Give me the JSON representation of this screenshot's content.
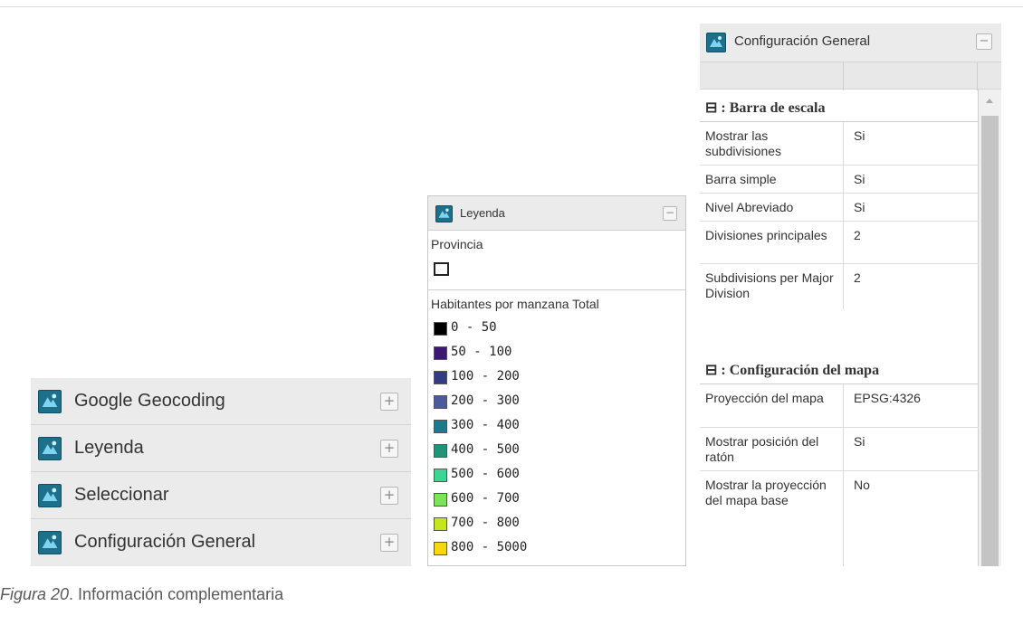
{
  "accordion": {
    "items": [
      {
        "label": "Google Geocoding",
        "icon": "layer-panel-icon"
      },
      {
        "label": "Leyenda",
        "icon": "layer-panel-icon"
      },
      {
        "label": "Seleccionar",
        "icon": "layer-panel-icon"
      },
      {
        "label": "Configuración General",
        "icon": "layer-panel-icon"
      }
    ],
    "expand_symbol": "+"
  },
  "legend_panel": {
    "title": "Leyenda",
    "collapse_symbol": "−",
    "group1_title": "Provincia",
    "group2_title": "Habitantes por manzana Total",
    "items": [
      {
        "label": "0 - 50",
        "color": "#000000"
      },
      {
        "label": "50 - 100",
        "color": "#3b1a6e"
      },
      {
        "label": "100 - 200",
        "color": "#333b85"
      },
      {
        "label": "200 - 300",
        "color": "#4a5a9a"
      },
      {
        "label": "300 - 400",
        "color": "#1d7a88"
      },
      {
        "label": "400 - 500",
        "color": "#1f9478"
      },
      {
        "label": "500 - 600",
        "color": "#3cd694"
      },
      {
        "label": "600 - 700",
        "color": "#7fe35a"
      },
      {
        "label": "700 - 800",
        "color": "#c5e51f"
      },
      {
        "label": "800 - 5000",
        "color": "#f5d910"
      }
    ]
  },
  "config_panel": {
    "title": "Configuración General",
    "collapse_symbol": "−",
    "section1": "⊟ : Barra de escala",
    "section1_props": [
      {
        "key": "Mostrar las subdivisiones",
        "value": "Si"
      },
      {
        "key": "Barra simple",
        "value": "Si"
      },
      {
        "key": "Nivel Abreviado",
        "value": "Si"
      },
      {
        "key": "Divisiones principales",
        "value": "2"
      },
      {
        "key": "Subdivisions per Major Division",
        "value": "2"
      }
    ],
    "section2": "⊟ : Configuración del mapa",
    "section2_props": [
      {
        "key": "Proyección del mapa",
        "value": "EPSG:4326"
      },
      {
        "key": "Mostrar posición del ratón",
        "value": "Si"
      },
      {
        "key": "Mostrar la proyección del mapa base",
        "value": "No"
      }
    ]
  },
  "caption": {
    "figure": "Figura 20",
    "text": ". Información complementaria"
  }
}
